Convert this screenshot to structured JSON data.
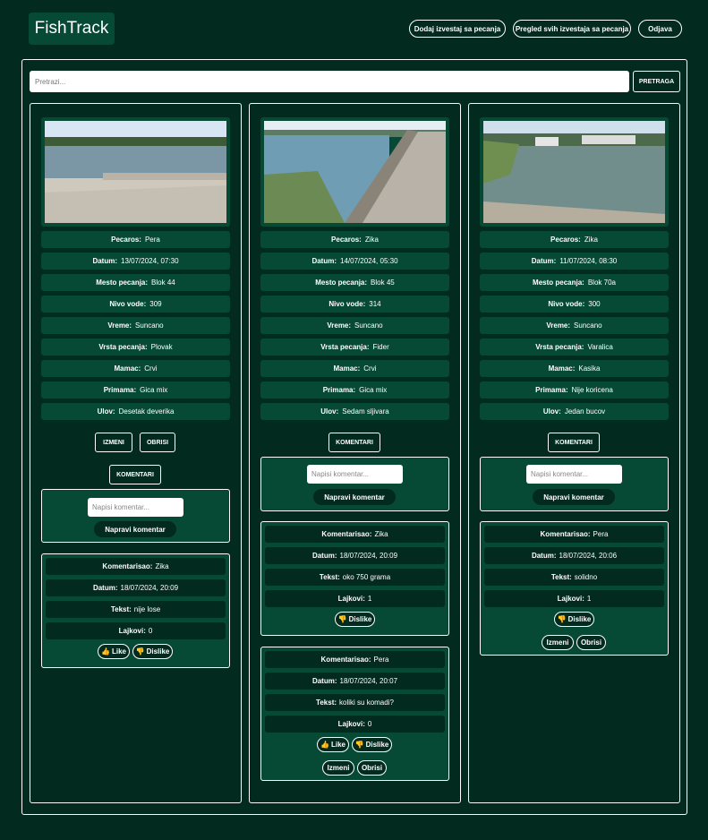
{
  "header": {
    "logo": "FishTrack",
    "nav": [
      "Dodaj izvestaj sa pecanja",
      "Pregled svih izvestaja sa pecanja",
      "Odjava"
    ]
  },
  "search": {
    "placeholder": "Pretrazi...",
    "button": "PRETRAGA"
  },
  "labels": {
    "angler": "Pecaros:",
    "date": "Datum:",
    "place": "Mesto pecanja:",
    "water": "Nivo vode:",
    "weather": "Vreme:",
    "type": "Vrsta pecanja:",
    "bait": "Mamac:",
    "bait2": "Primama:",
    "catch": "Ulov:",
    "edit": "IZMENI",
    "delete": "OBRISI",
    "comments": "KOMENTARI",
    "comment_placeholder": "Napisi komentar...",
    "make_comment": "Napravi komentar",
    "commented_by": "Komentarisao:",
    "c_date": "Datum:",
    "c_text": "Tekst:",
    "c_likes": "Lajkovi:",
    "like": "Like",
    "dislike": "Dislike",
    "c_edit": "Izmeni",
    "c_delete": "Obrisi"
  },
  "reports": [
    {
      "angler": "Pera",
      "date": "13/07/2024, 07:30",
      "place": "Blok 44",
      "water": "309",
      "weather": "Suncano",
      "type": "Plovak",
      "bait": "Crvi",
      "bait2": "Gica mix",
      "catch": "Desetak deverika",
      "comments": [
        {
          "author": "Zika",
          "date": "18/07/2024, 20:09",
          "text": "nije lose",
          "likes": "0"
        }
      ]
    },
    {
      "angler": "Zika",
      "date": "14/07/2024, 05:30",
      "place": "Blok 45",
      "water": "314",
      "weather": "Suncano",
      "type": "Fider",
      "bait": "Crvi",
      "bait2": "Gica mix",
      "catch": "Sedam sljivara",
      "comments": [
        {
          "author": "Zika",
          "date": "18/07/2024, 20:09",
          "text": "oko 750 grama",
          "likes": "1"
        },
        {
          "author": "Pera",
          "date": "18/07/2024, 20:07",
          "text": "koliki su komadi?",
          "likes": "0"
        }
      ]
    },
    {
      "angler": "Zika",
      "date": "11/07/2024, 08:30",
      "place": "Blok 70a",
      "water": "300",
      "weather": "Suncano",
      "type": "Varalica",
      "bait": "Kasika",
      "bait2": "Nije koricena",
      "catch": "Jedan bucov",
      "comments": [
        {
          "author": "Pera",
          "date": "18/07/2024, 20:06",
          "text": "solidno",
          "likes": "1"
        }
      ]
    }
  ],
  "colors": {
    "background": "#032a1e",
    "card": "#064a36",
    "accent": "#ffffff"
  }
}
